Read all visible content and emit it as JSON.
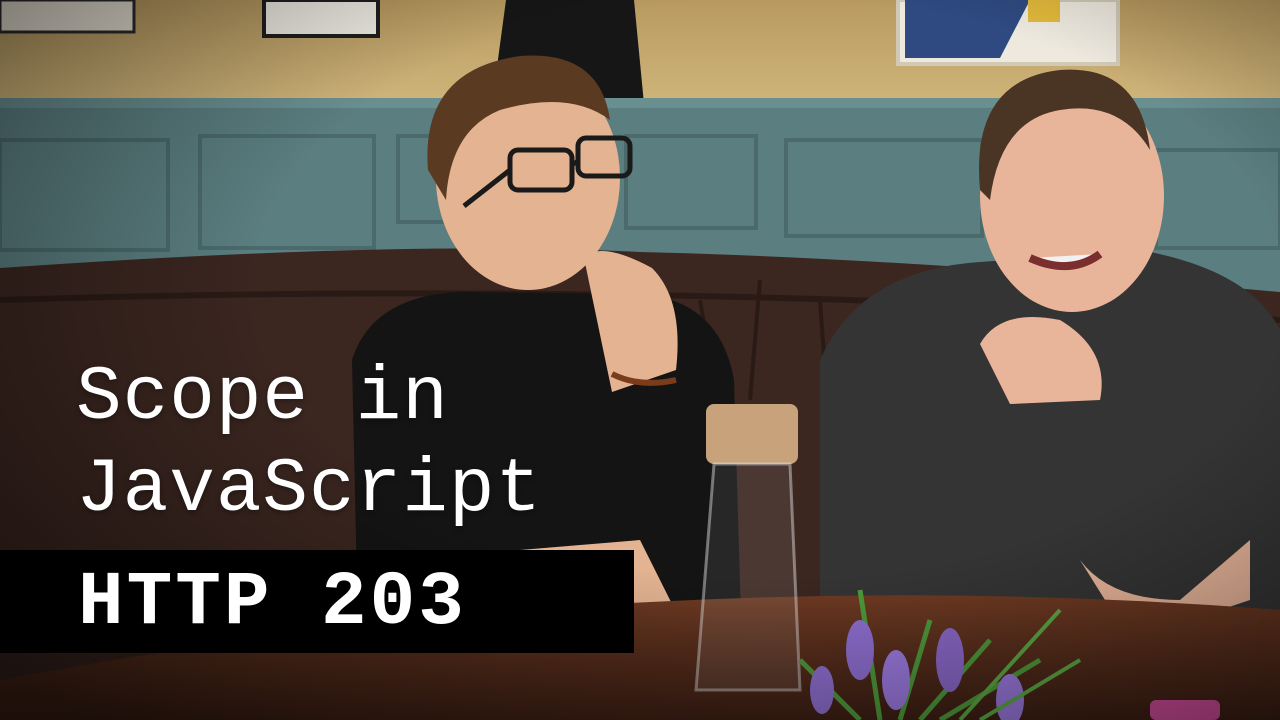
{
  "title": {
    "line1": "Scope in",
    "line2": "JavaScript"
  },
  "show": {
    "name": "HTTP 203"
  },
  "colors": {
    "wall": "#c9ad72",
    "panel": "#5b7e80",
    "sofa": "#3b2620",
    "table": "#5a2f1d",
    "bar": "#000000",
    "text": "#ffffff"
  }
}
